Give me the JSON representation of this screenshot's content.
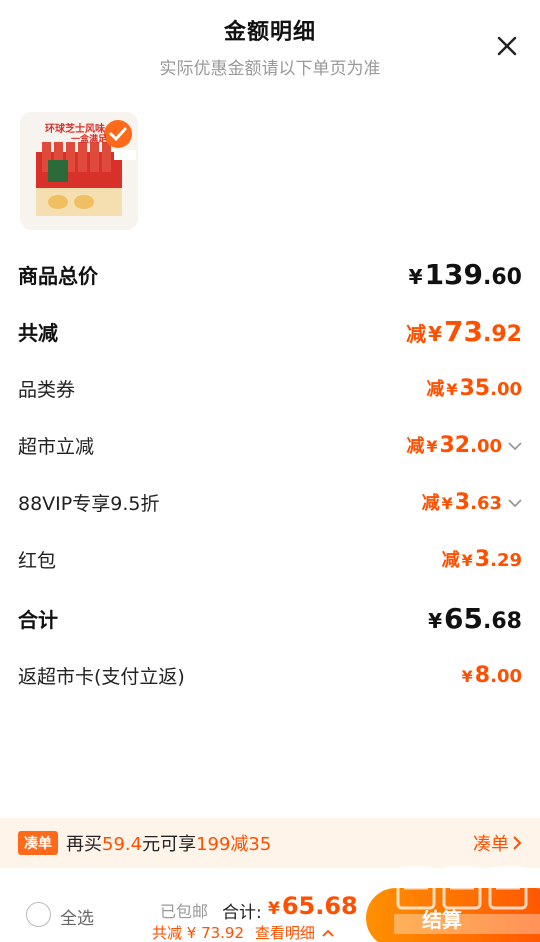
{
  "header": {
    "title": "金额明细",
    "subtitle": "实际优惠金额请以下单页为准"
  },
  "rows": [
    {
      "label": "商品总价",
      "minus": "",
      "yen": "¥",
      "int": "139",
      "dec": ".60"
    },
    {
      "label": "共减",
      "minus": "减",
      "yen": "¥",
      "int": "73",
      "dec": ".92"
    },
    {
      "label": "品类券",
      "minus": "减",
      "yen": "¥",
      "int": "35",
      "dec": ".00"
    },
    {
      "label": "超市立减",
      "minus": "减",
      "yen": "¥",
      "int": "32",
      "dec": ".00"
    },
    {
      "label": "88VIP专享9.5折",
      "minus": "减",
      "yen": "¥",
      "int": "3",
      "dec": ".63"
    },
    {
      "label": "红包",
      "minus": "减",
      "yen": "¥",
      "int": "3",
      "dec": ".29"
    },
    {
      "label": "合计",
      "minus": "",
      "yen": "¥",
      "int": "65",
      "dec": ".68"
    },
    {
      "label": "返超市卡(支付立返)",
      "minus": "",
      "yen": "¥",
      "int": "8",
      "dec": ".00"
    }
  ],
  "promo": {
    "tag": "凑单",
    "text_a": "再买",
    "amount": "59.4",
    "text_b": "元可享",
    "deal": "199减35",
    "link": "凑单"
  },
  "bottom": {
    "select_all": "全选",
    "shipping": "已包邮",
    "total_label": "合计:",
    "yen": "¥",
    "total": "65.68",
    "saved": "共减 ¥ 73.92",
    "detail": "查看明细",
    "checkout": "结算"
  },
  "product": {
    "package_text_1": "环球芝士风味",
    "package_text_2": "一盒满足"
  },
  "colors": {
    "accent": "#ff5000",
    "promo_bg": "#fff4ea"
  }
}
